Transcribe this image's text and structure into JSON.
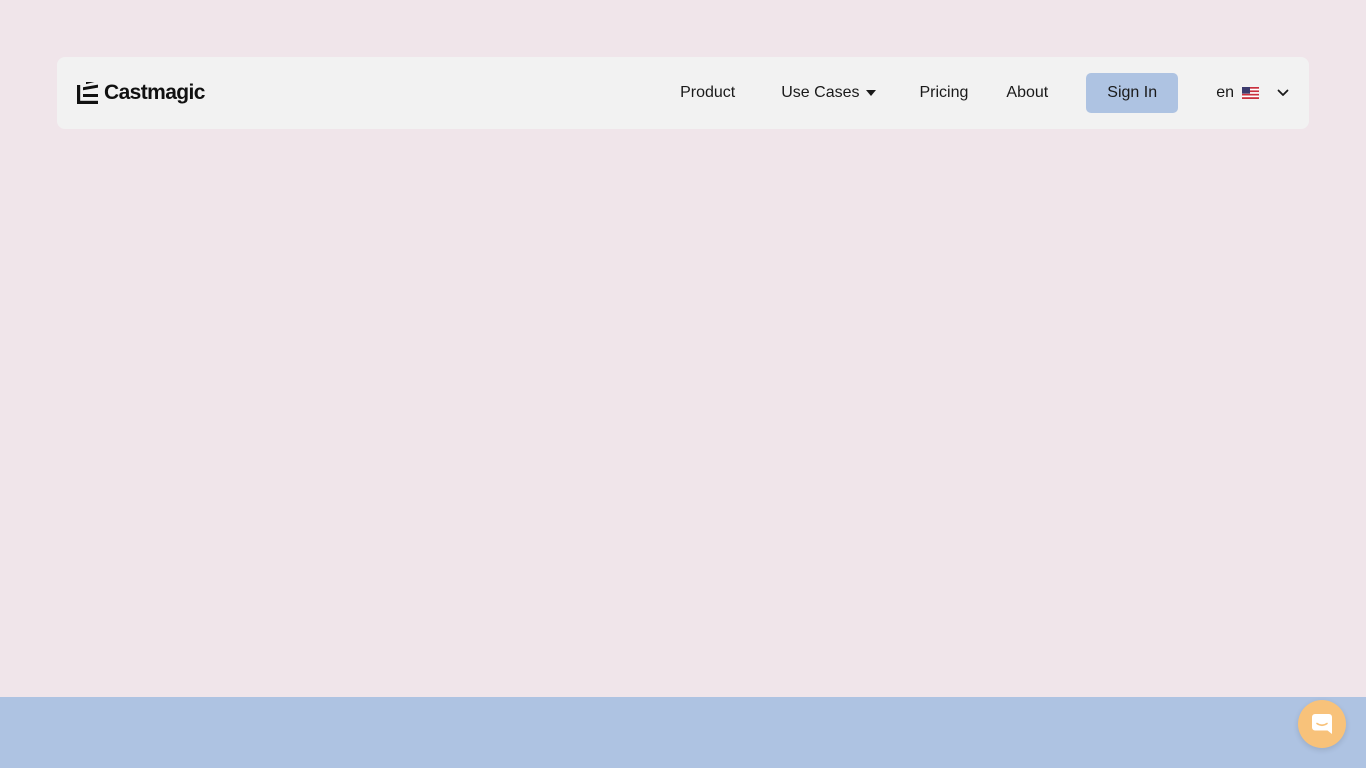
{
  "brand": {
    "name": "Castmagic"
  },
  "nav": {
    "items": [
      {
        "label": "Product"
      },
      {
        "label": "Use Cases"
      },
      {
        "label": "Pricing"
      },
      {
        "label": "About"
      }
    ],
    "signin_label": "Sign In",
    "language": {
      "code": "en",
      "flag_icon": "us-flag-icon"
    }
  },
  "icons": {
    "logo": "castmagic-logo-icon",
    "use_cases_caret": "caret-down-icon",
    "language_chevron": "chevron-down-icon",
    "chat": "chat-icon"
  },
  "colors": {
    "page_background": "#f0e5ea",
    "navbar_background": "#f2f2f2",
    "signin_button": "#aec3e2",
    "footer_band": "#aec3e2",
    "chat_launcher": "#f8c27a",
    "text": "#1a1a1a"
  }
}
